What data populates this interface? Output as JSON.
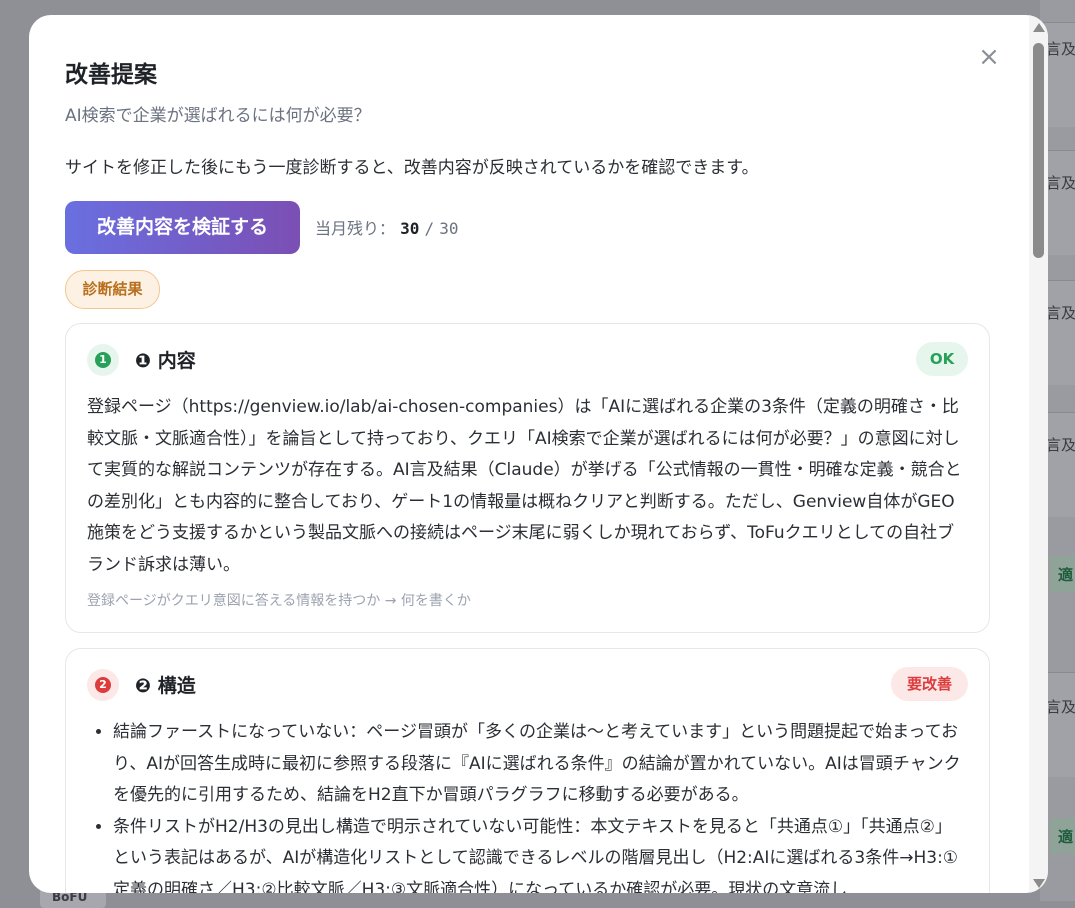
{
  "background": {
    "row_text": "言及",
    "ok_text": "適",
    "bottom_tag": "BoFU"
  },
  "modal": {
    "title": "改善提案",
    "query": "AI検索で企業が選ばれるには何が必要？",
    "description": "サイトを修正した後にもう一度診断すると、改善内容が反映されているかを確認できます。",
    "close_icon": "×",
    "verify_button": "改善内容を検証する",
    "quota": {
      "label": "当月残り：",
      "remaining": "30",
      "separator": "/",
      "total": "30"
    },
    "diagnosis_badge": "診断結果"
  },
  "cards": [
    {
      "number": "1",
      "title": "❶ 内容",
      "status": "OK",
      "body": "登録ページ（https://genview.io/lab/ai-chosen-companies）は「AIに選ばれる企業の3条件（定義の明確さ・比較文脈・文脈適合性）」を論旨として持っており、クエリ「AI検索で企業が選ばれるには何が必要？」の意図に対して実質的な解説コンテンツが存在する。AI言及結果（Claude）が挙げる「公式情報の一貫性・明確な定義・競合との差別化」とも内容的に整合しており、ゲート1の情報量は概ねクリアと判断する。ただし、Genview自体がGEO施策をどう支援するかという製品文脈への接続はページ末尾に弱くしか現れておらず、ToFuクエリとしての自社ブランド訴求は薄い。",
      "hint": "登録ページがクエリ意図に答える情報を持つか → 何を書くか"
    },
    {
      "number": "2",
      "title": "❷ 構造",
      "status": "要改善",
      "bullets": [
        "結論ファーストになっていない：ページ冒頭が「多くの企業は〜と考えています」という問題提起で始まっており、AIが回答生成時に最初に参照する段落に『AIに選ばれる条件』の結論が置かれていない。AIは冒頭チャンクを優先的に引用するため、結論をH2直下か冒頭パラグラフに移動する必要がある。",
        "条件リストがH2/H3の見出し構造で明示されていない可能性：本文テキストを見ると「共通点①」「共通点②」という表記はあるが、AIが構造化リストとして認識できるレベルの階層見出し（H2:AIに選ばれる3条件→H3:①定義の明確さ／H3:②比較文脈／H3:③文脈適合性）になっているか確認が必要。現状の文章流し"
      ]
    }
  ]
}
